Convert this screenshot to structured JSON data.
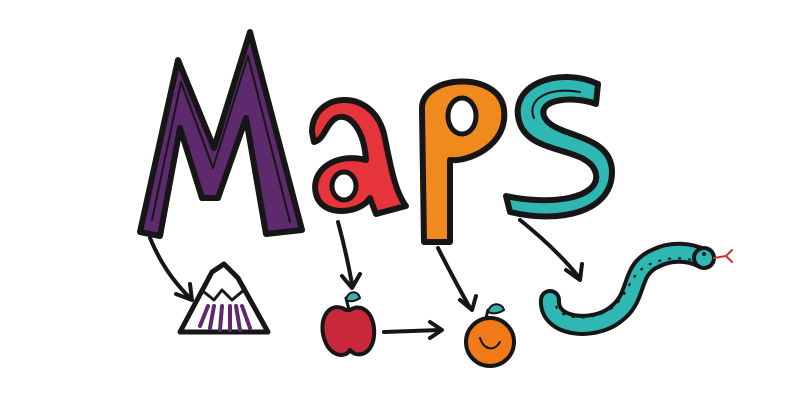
{
  "word": "MaPS",
  "colors": {
    "background": "#ffffff",
    "ink": "#161616",
    "letter_m": "#5e2a6e",
    "letter_a": "#e5353b",
    "letter_p": "#f08a1e",
    "letter_s": "#2fb7b4",
    "apple_red": "#c8283a",
    "orange_fruit": "#f07a18",
    "leaf": "#33b3aa",
    "snake_body": "#2fb7b4",
    "snake_tongue": "#c0392b",
    "mountain_stripes": "#5e2a6e"
  },
  "pictures": [
    {
      "letter": "M",
      "picture": "mountain-icon"
    },
    {
      "letter": "a",
      "picture": "apple-icon"
    },
    {
      "letter": "P",
      "picture": "peach-icon"
    },
    {
      "letter": "S",
      "picture": "snake-icon"
    }
  ]
}
